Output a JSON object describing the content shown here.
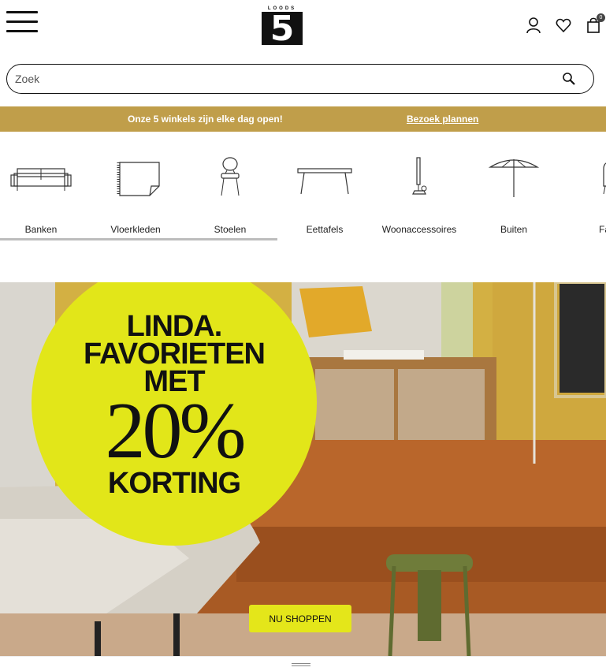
{
  "header": {
    "logo_top": "LOODS",
    "logo_number": "5",
    "cart_count": "0"
  },
  "search": {
    "placeholder": "Zoek"
  },
  "promo": {
    "text": "Onze 5 winkels zijn elke dag open!",
    "link": "Bezoek plannen",
    "color": "#c09e4a"
  },
  "categories": [
    {
      "label": "Banken",
      "icon": "sofa-icon"
    },
    {
      "label": "Vloerkleden",
      "icon": "rug-icon"
    },
    {
      "label": "Stoelen",
      "icon": "chair-icon"
    },
    {
      "label": "Eettafels",
      "icon": "table-icon"
    },
    {
      "label": "Woonaccessoires",
      "icon": "candle-holder-icon"
    },
    {
      "label": "Buiten",
      "icon": "parasol-icon"
    },
    {
      "label": "Faut",
      "icon": "armchair-icon"
    }
  ],
  "hero": {
    "line1": "LINDA.",
    "line2": "FAVORIETEN",
    "line3": "MET",
    "line4": "20%",
    "line5": "KORTING",
    "button": "NU SHOPPEN",
    "badge_color": "#e2e619"
  }
}
